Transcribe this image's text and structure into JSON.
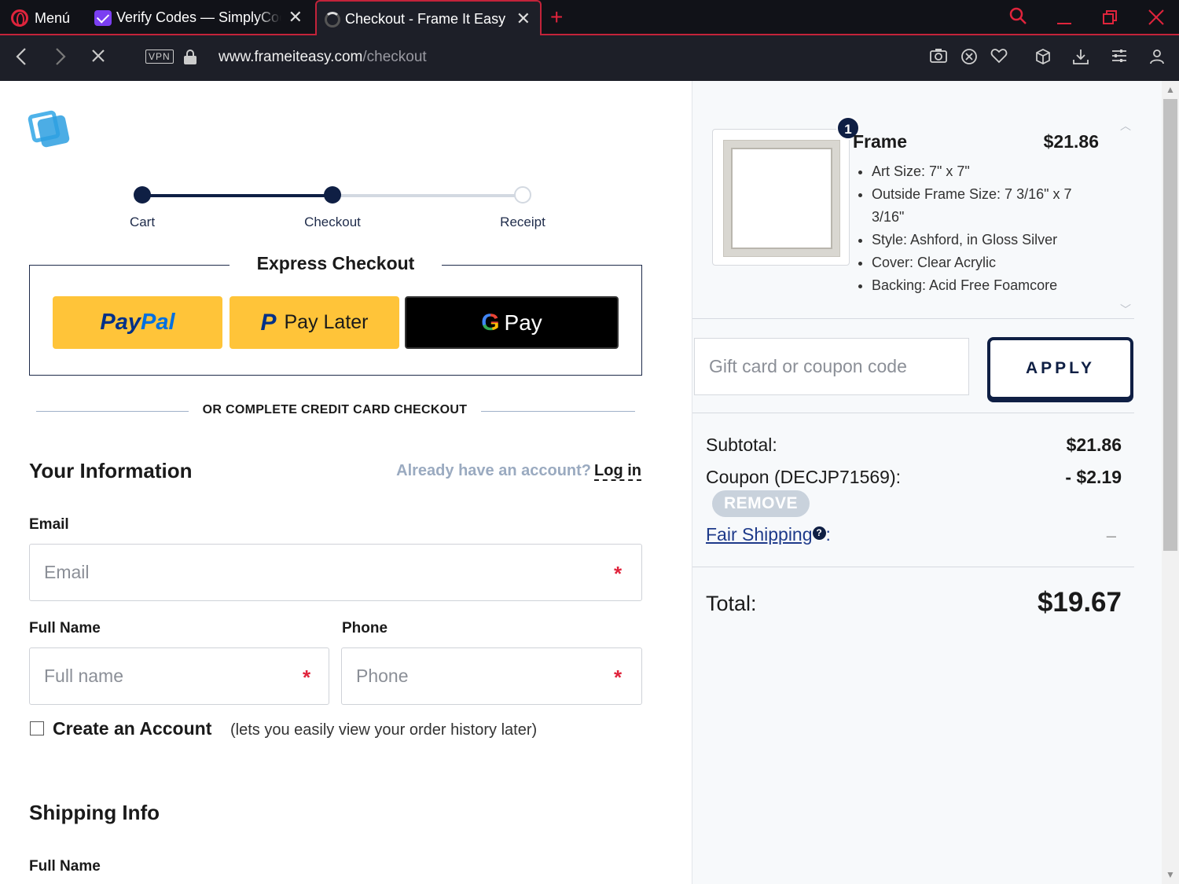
{
  "browser": {
    "menu_label": "Menú",
    "tabs": [
      {
        "title": "Verify Codes — SimplyCodes"
      },
      {
        "title": "Checkout - Frame It Easy"
      }
    ],
    "url_host": "www.frameiteasy.com",
    "url_path": "/checkout",
    "vpn_label": "VPN",
    "accent_color": "#e0243c"
  },
  "progress": {
    "steps": [
      "Cart",
      "Checkout",
      "Receipt"
    ],
    "current_step": 2
  },
  "express": {
    "title": "Express Checkout",
    "paypal_a": "Pay",
    "paypal_b": "Pal",
    "paylater_label": "Pay Later",
    "gpay_label": "Pay"
  },
  "divider_text": "OR COMPLETE CREDIT CARD CHECKOUT",
  "your_info": {
    "title": "Your Information",
    "account_question": "Already have an account?",
    "login_label": "Log in",
    "email_label": "Email",
    "email_placeholder": "Email",
    "fullname_label": "Full Name",
    "fullname_placeholder": "Full name",
    "phone_label": "Phone",
    "phone_placeholder": "Phone",
    "required_mark": "*",
    "create_account_label": "Create an Account",
    "create_account_note": "(lets you easily view your order history later)"
  },
  "shipping": {
    "title": "Shipping Info",
    "fullname_label": "Full Name"
  },
  "cart": {
    "item": {
      "quantity": "1",
      "name": "Frame",
      "price": "$21.86",
      "attributes": [
        "Art Size: 7\" x 7\"",
        "Outside Frame Size: 7 3/16\" x 7 3/16\"",
        "Style: Ashford, in Gloss Silver",
        "Cover: Clear Acrylic",
        "Backing: Acid Free Foamcore"
      ]
    },
    "coupon_placeholder": "Gift card or coupon code",
    "apply_label": "APPLY",
    "subtotal_label": "Subtotal:",
    "subtotal_value": "$21.86",
    "coupon_label": "Coupon (DECJP71569):",
    "coupon_value": "- $2.19",
    "remove_label": "REMOVE",
    "shipping_label": "Fair Shipping",
    "shipping_help": "?",
    "shipping_value": "–",
    "total_label": "Total:",
    "total_value": "$19.67"
  }
}
